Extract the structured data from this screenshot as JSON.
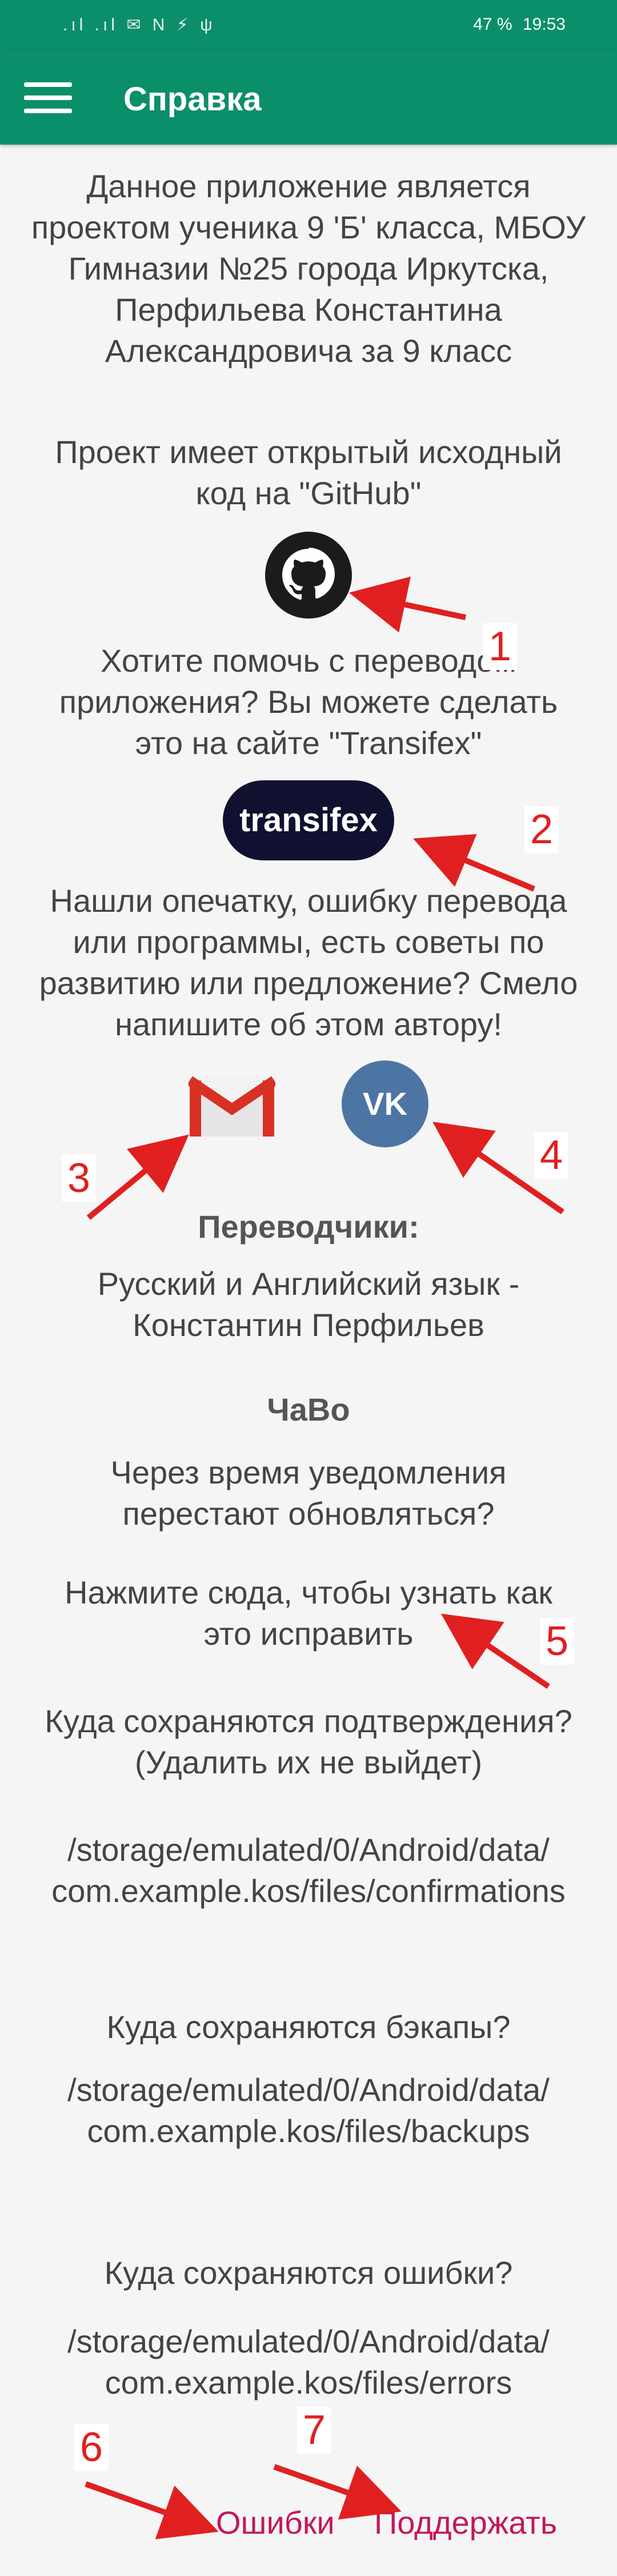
{
  "status": {
    "left": ".ıl .ıl ✉ N ⚡ ψ",
    "battery": "47 %",
    "time": "19:53"
  },
  "toolbar": {
    "title": "Справка"
  },
  "content": {
    "about": "Данное приложение является проектом ученика 9 'Б' класса, МБОУ Гимназии №25 города Иркутска, Перфильева Константина Александровича за 9 класс",
    "opensource": "Проект имеет открытый исходный код на \"GitHub\"",
    "help_translate": "Хотите помочь с переводом приложения? Вы можете сделать это на сайте \"Transifex\"",
    "transifex_label": "transifex",
    "feedback": "Нашли опечатку, ошибку перевода или программы, есть советы по развитию или предложение? Смело напишите об этом автору!",
    "translators_title": "Переводчики:",
    "translators_text": "Русский и Английский язык - Константин Перфильев",
    "faq_title": "ЧаВо",
    "faq_q1": "Через время уведомления перестают обновляться?",
    "faq_a1_link": "Нажмите сюда, чтобы узнать как это исправить",
    "confirm_q": "Куда сохраняются подтверждения? (Удалить их не выйдет)",
    "confirm_path": "/storage/emulated/0/Android/data/ com.example.kos/files/confirmations",
    "backup_q": "Куда сохраняются бэкапы?",
    "backup_path": "/storage/emulated/0/Android/data/ com.example.kos/files/backups",
    "errors_q": "Куда сохраняются ошибки?",
    "errors_path": "/storage/emulated/0/Android/data/ com.example.kos/files/errors"
  },
  "bottom": {
    "errors_btn": "Ошибки",
    "support_btn": "Поддержать"
  },
  "annotations": [
    "1",
    "2",
    "3",
    "4",
    "5",
    "6",
    "7"
  ],
  "icons": {
    "menu": "hamburger-icon",
    "github": "github-icon",
    "gmail": "gmail-icon",
    "vk": "vk-icon"
  }
}
